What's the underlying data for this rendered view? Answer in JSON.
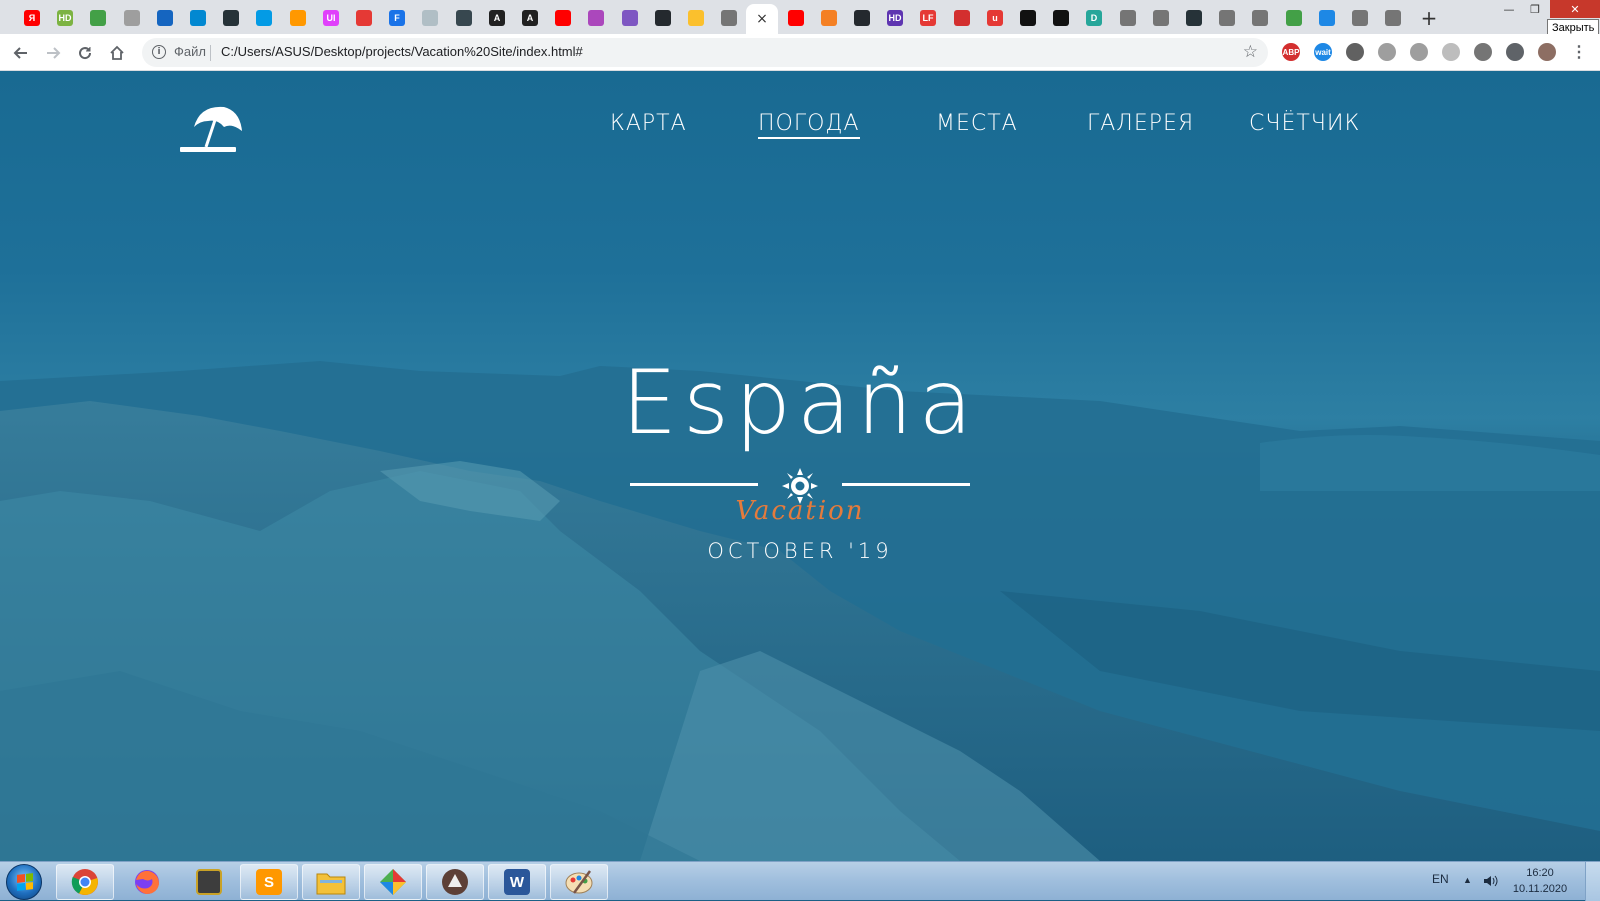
{
  "browser": {
    "tabs": [
      {
        "icon": "yandex-icon",
        "label": "Я",
        "color": "#ff0000"
      },
      {
        "icon": "hd-icon",
        "label": "HD",
        "color": "#7cb342"
      },
      {
        "icon": "dots-icon",
        "label": "",
        "color": "#43a047"
      },
      {
        "icon": "generic-icon",
        "label": "",
        "color": "#9e9e9e"
      },
      {
        "icon": "flag-icon",
        "label": "",
        "color": "#1565c0"
      },
      {
        "icon": "star-burst-icon",
        "label": "",
        "color": "#0288d1"
      },
      {
        "icon": "react-icon",
        "label": "",
        "color": "#263238"
      },
      {
        "icon": "snowflake-icon",
        "label": "",
        "color": "#039be5"
      },
      {
        "icon": "gear-icon",
        "label": "",
        "color": "#ff9800"
      },
      {
        "icon": "ui-icon",
        "label": "UI",
        "color": "#e040fb"
      },
      {
        "icon": "triangle-icon",
        "label": "",
        "color": "#e53935"
      },
      {
        "icon": "f-icon",
        "label": "F",
        "color": "#1a73e8"
      },
      {
        "icon": "pencil-icon",
        "label": "",
        "color": "#b0bec5"
      },
      {
        "icon": "bulb-icon",
        "label": "",
        "color": "#37474f"
      },
      {
        "icon": "angular-icon",
        "label": "A",
        "color": "#212121"
      },
      {
        "icon": "angular-icon",
        "label": "A",
        "color": "#212121"
      },
      {
        "icon": "youtube-icon",
        "label": "",
        "color": "#ff0000"
      },
      {
        "icon": "dots-grid-icon",
        "label": "",
        "color": "#ab47bc"
      },
      {
        "icon": "layers-icon",
        "label": "",
        "color": "#7e57c2"
      },
      {
        "icon": "github-icon",
        "label": "",
        "color": "#24292e"
      },
      {
        "icon": "crown-icon",
        "label": "",
        "color": "#fbc02d"
      },
      {
        "icon": "globe-icon",
        "label": "",
        "color": "#757575"
      },
      {
        "icon": "close-icon",
        "label": "×",
        "color": "#ffffff",
        "active": true
      },
      {
        "icon": "youtube-icon",
        "label": "",
        "color": "#ff0000"
      },
      {
        "icon": "stackoverflow-icon",
        "label": "",
        "color": "#f48024"
      },
      {
        "icon": "github-icon",
        "label": "",
        "color": "#24292e"
      },
      {
        "icon": "hd-icon",
        "label": "HD",
        "color": "#5e35b1"
      },
      {
        "icon": "lf-icon",
        "label": "LF",
        "color": "#e53935"
      },
      {
        "icon": "badge-icon",
        "label": "",
        "color": "#d32f2f"
      },
      {
        "icon": "u-icon",
        "label": "u",
        "color": "#e53935"
      },
      {
        "icon": "stamp-icon",
        "label": "",
        "color": "#111111"
      },
      {
        "icon": "codepen-icon",
        "label": "",
        "color": "#111111"
      },
      {
        "icon": "d-icon",
        "label": "D",
        "color": "#26a69a"
      },
      {
        "icon": "globe-icon",
        "label": "",
        "color": "#757575"
      },
      {
        "icon": "globe-icon",
        "label": "",
        "color": "#757575"
      },
      {
        "icon": "react-icon",
        "label": "",
        "color": "#263238"
      },
      {
        "icon": "globe-icon",
        "label": "",
        "color": "#757575"
      },
      {
        "icon": "globe-icon",
        "label": "",
        "color": "#757575"
      },
      {
        "icon": "bars-icon",
        "label": "",
        "color": "#43a047"
      },
      {
        "icon": "gear-icon",
        "label": "",
        "color": "#1e88e5"
      },
      {
        "icon": "globe-icon",
        "label": "",
        "color": "#757575"
      },
      {
        "icon": "globe-icon",
        "label": "",
        "color": "#757575"
      }
    ],
    "new_tab_label": "+",
    "tooltip": "Закрыть",
    "window": {
      "minimize": "—",
      "maximize": "❐",
      "close": "✕"
    },
    "scheme_label": "Файл",
    "url": "C:/Users/ASUS/Desktop/projects/Vacation%20Site/index.html#",
    "extensions": [
      {
        "icon": "adblock-icon",
        "label": "ABP",
        "color": "#d32f2f"
      },
      {
        "icon": "wait-icon",
        "label": "wait",
        "color": "#1e88e5"
      },
      {
        "icon": "extension-icon",
        "label": "",
        "color": "#616161"
      },
      {
        "icon": "pdf-icon",
        "label": "",
        "color": "#9e9e9e"
      },
      {
        "icon": "globe-icon",
        "label": "",
        "color": "#9e9e9e"
      },
      {
        "icon": "grid-icon",
        "label": "",
        "color": "#bdbdbd"
      },
      {
        "icon": "puzzle-piece-icon",
        "label": "",
        "color": "#757575"
      },
      {
        "icon": "puzzle-icon",
        "label": "",
        "color": "#5f6368"
      },
      {
        "icon": "avatar-icon",
        "label": "",
        "color": "#8d6e63"
      },
      {
        "icon": "more-icon",
        "label": "⋮",
        "color": "#5f6368"
      }
    ]
  },
  "site": {
    "logo_icon": "beach-umbrella-icon",
    "nav": [
      {
        "label": "КАРТА",
        "active": false
      },
      {
        "label": "ПОГОДА",
        "active": true
      },
      {
        "label": "МЕСТА",
        "active": false
      },
      {
        "label": "ГАЛЕРЕЯ",
        "active": false
      },
      {
        "label": "СЧЁТЧИК",
        "active": false
      }
    ],
    "hero": {
      "title": "España",
      "divider_icon": "sun-icon",
      "subtitle": "Vacation",
      "date": "OCTOBER '19"
    },
    "colors": {
      "overlay": "#1a6a93",
      "accent": "#e57b3c",
      "text": "#ffffff"
    }
  },
  "taskbar": {
    "apps": [
      {
        "name": "chrome",
        "icon": "chrome-icon"
      },
      {
        "name": "firefox",
        "icon": "firefox-icon"
      },
      {
        "name": "camera",
        "icon": "camera-icon"
      },
      {
        "name": "sublime",
        "icon": "sublime-icon",
        "label": "S"
      },
      {
        "name": "explorer",
        "icon": "folder-icon"
      },
      {
        "name": "gitkraken",
        "icon": "diamond-icon"
      },
      {
        "name": "app",
        "icon": "circle-app-icon"
      },
      {
        "name": "word",
        "icon": "word-icon",
        "label": "W"
      },
      {
        "name": "paint",
        "icon": "paint-icon"
      }
    ],
    "lang": "EN",
    "time": "16:20",
    "date": "10.11.2020"
  }
}
